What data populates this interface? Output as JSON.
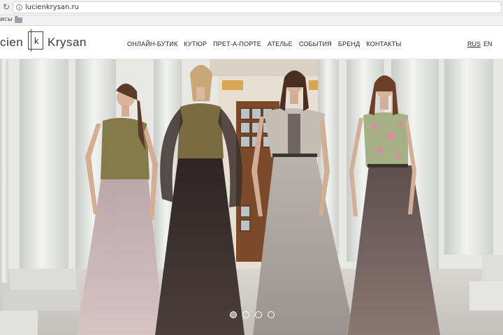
{
  "browser": {
    "url": "lucienkrysan.ru",
    "bookmarks_label": "исы"
  },
  "header": {
    "logo_left": "cien",
    "logo_mark": "k",
    "logo_right": "Krysan",
    "nav": [
      "ОНЛАЙН-БУТИК",
      "КУТЮР",
      "ПРЕТ-А-ПОРТЕ",
      "АТЕЛЬЕ",
      "СОБЫТИЯ",
      "БРЕНД",
      "КОНТАКТЫ"
    ],
    "lang_active": "RUS",
    "lang_other": "EN"
  },
  "hero": {
    "slide_count": 4,
    "active_slide": 1
  },
  "colors": {
    "header_bg": "#ffffff",
    "chrome_bg": "#f2f2f2"
  }
}
